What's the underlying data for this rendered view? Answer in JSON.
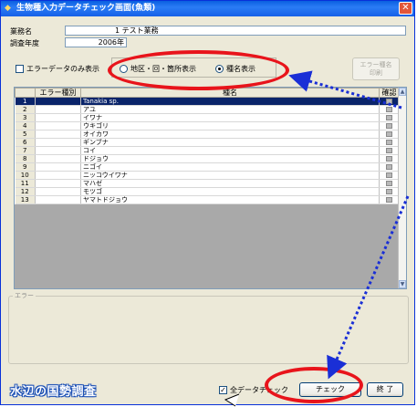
{
  "window": {
    "title": "生物種入力データチェック画面(魚類)",
    "close_glyph": "✕"
  },
  "info": {
    "gyomu_label": "業務名",
    "gyomu_value": "1 テスト業務",
    "nendo_label": "調査年度",
    "nendo_value": "2006年"
  },
  "filters": {
    "error_only_label": "エラーデータのみ表示",
    "error_only_checked": false,
    "radio_options": [
      {
        "label": "地区・回・箇所表示",
        "selected": false
      },
      {
        "label": "種名表示",
        "selected": true
      }
    ],
    "error_species_button_line1": "エラー種名",
    "error_species_button_line2": "印刷"
  },
  "grid": {
    "headers": {
      "row_no": "",
      "error_type": "エラー種別",
      "species": "種名",
      "check": "確認"
    },
    "rows": [
      {
        "no": "1",
        "error": "",
        "name": "Tanakia sp.",
        "selected": true
      },
      {
        "no": "2",
        "error": "",
        "name": "アユ",
        "selected": false
      },
      {
        "no": "3",
        "error": "",
        "name": "イワナ",
        "selected": false
      },
      {
        "no": "4",
        "error": "",
        "name": "ウキゴリ",
        "selected": false
      },
      {
        "no": "5",
        "error": "",
        "name": "オイカワ",
        "selected": false
      },
      {
        "no": "6",
        "error": "",
        "name": "ギンブナ",
        "selected": false
      },
      {
        "no": "7",
        "error": "",
        "name": "コイ",
        "selected": false
      },
      {
        "no": "8",
        "error": "",
        "name": "ドジョウ",
        "selected": false
      },
      {
        "no": "9",
        "error": "",
        "name": "ニゴイ",
        "selected": false
      },
      {
        "no": "10",
        "error": "",
        "name": "ニッコウイワナ",
        "selected": false
      },
      {
        "no": "11",
        "error": "",
        "name": "マハゼ",
        "selected": false
      },
      {
        "no": "12",
        "error": "",
        "name": "モツゴ",
        "selected": false
      },
      {
        "no": "13",
        "error": "",
        "name": "ヤマトドジョウ",
        "selected": false
      }
    ]
  },
  "message_box": {
    "legend": "エラー"
  },
  "footer": {
    "logo_text": "水辺の国勢調査",
    "all_check_label": "全データチェック",
    "all_check_checked": true,
    "check_button": "チェック",
    "exit_button": "終 了"
  },
  "colors": {
    "annotation_red": "#e8141b",
    "annotation_blue": "#1a2fd6",
    "selection": "#0a246a",
    "titlebar": "#0a5fe0"
  }
}
